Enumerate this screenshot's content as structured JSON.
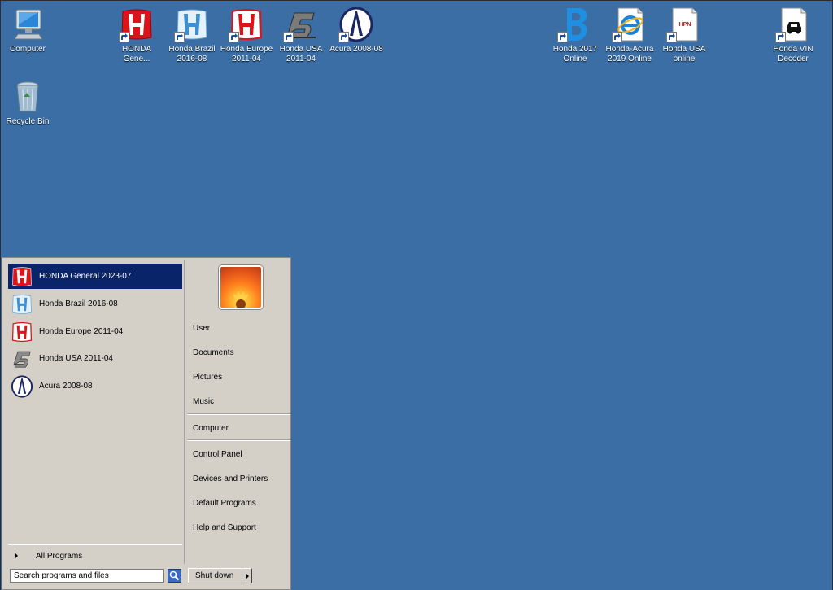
{
  "desktop": {
    "background": "#3a6ea5",
    "icons": [
      {
        "label": "Computer",
        "icon": "computer-icon"
      },
      {
        "label": "Recycle Bin",
        "icon": "recycle-bin-icon"
      },
      {
        "label": "HONDA Gene...",
        "icon": "honda-red-icon"
      },
      {
        "label": "Honda Brazil 2016-08",
        "icon": "honda-blue-icon"
      },
      {
        "label": "Honda Europe 2011-04",
        "icon": "honda-red-icon"
      },
      {
        "label": "Honda USA 2011-04",
        "icon": "honda-usa-icon"
      },
      {
        "label": "Acura 2008-08",
        "icon": "acura-icon"
      },
      {
        "label": "Honda 2017 Online",
        "icon": "honda-2017-icon"
      },
      {
        "label": "Honda-Acura 2019 Online",
        "icon": "internet-explorer-icon"
      },
      {
        "label": "Honda USA online",
        "icon": "hpn-document-icon"
      },
      {
        "label": "Honda VIN Decoder",
        "icon": "vin-decoder-icon"
      }
    ]
  },
  "start_menu": {
    "programs": [
      {
        "label": "HONDA General 2023-07",
        "icon": "honda-red-icon",
        "selected": true
      },
      {
        "label": "Honda Brazil 2016-08",
        "icon": "honda-blue-icon"
      },
      {
        "label": "Honda Europe 2011-04",
        "icon": "honda-red-icon"
      },
      {
        "label": "Honda USA 2011-04",
        "icon": "honda-usa-icon"
      },
      {
        "label": "Acura 2008-08",
        "icon": "acura-icon"
      }
    ],
    "all_programs": "All Programs",
    "right": {
      "user": "User",
      "documents": "Documents",
      "pictures": "Pictures",
      "music": "Music",
      "computer": "Computer",
      "control_panel": "Control Panel",
      "devices_printers": "Devices and Printers",
      "default_programs": "Default Programs",
      "help_support": "Help and Support"
    },
    "search_placeholder": "Search programs and files",
    "shutdown_label": "Shut down",
    "selection_color": "#0a246a"
  }
}
